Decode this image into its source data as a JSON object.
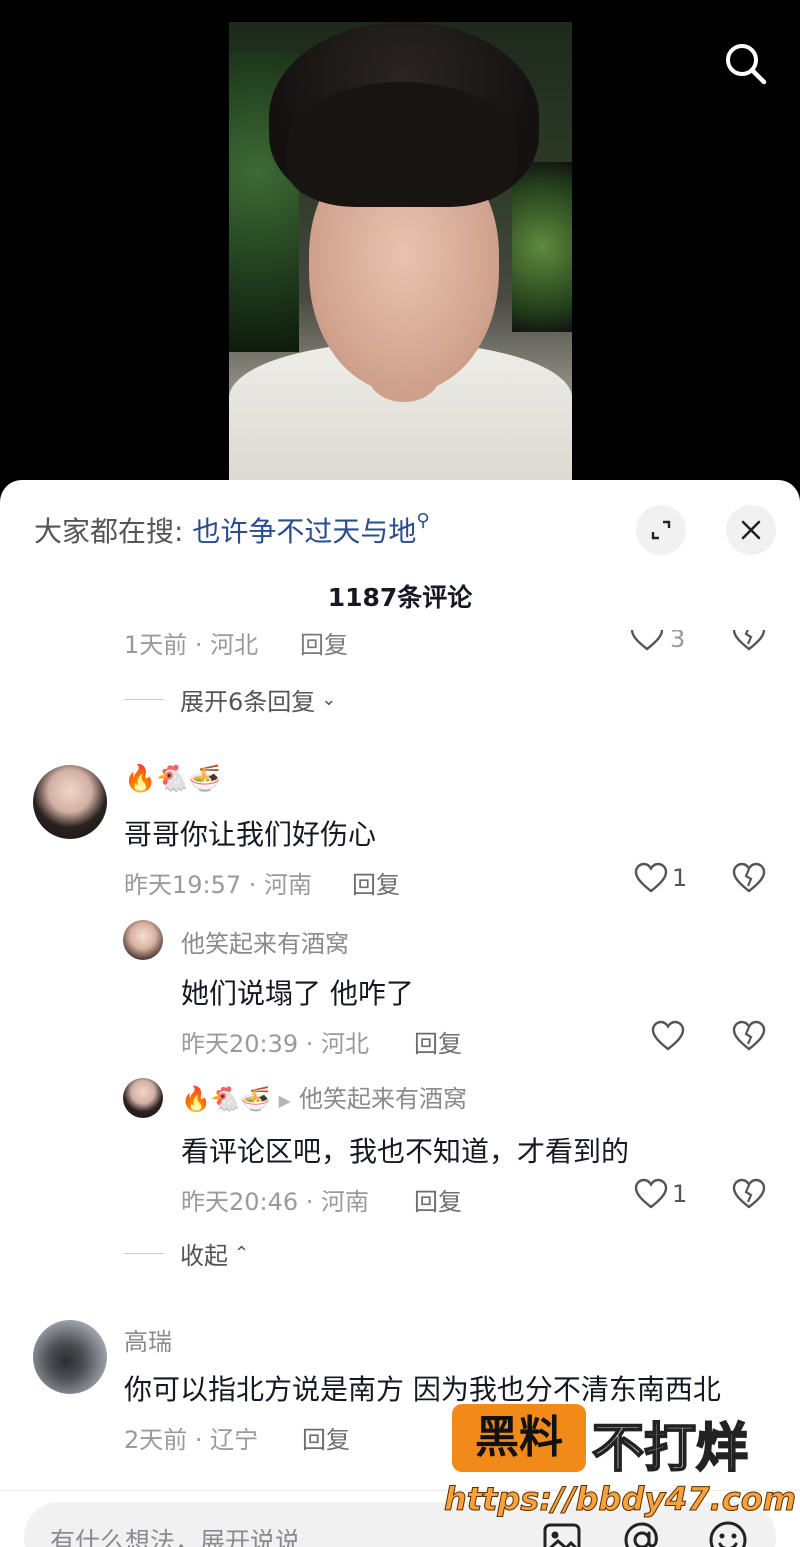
{
  "hot_search": {
    "prefix": "大家都在搜:",
    "term": "也许争不过天与地",
    "icon": "search-icon"
  },
  "comment_count_title": "1187条评论",
  "cut_off_comment": {
    "meta": "1天前 · 河北",
    "reply_label": "回复",
    "likes": "3"
  },
  "expand_replies_label": "展开6条回复",
  "comments": [
    {
      "user": "🔥🐔🍜",
      "text": "哥哥你让我们好伤心",
      "meta": "昨天19:57 · 河南",
      "reply_label": "回复",
      "likes": "1"
    },
    {
      "user": "他笑起来有酒窝",
      "text": "她们说塌了 他咋了",
      "meta": "昨天20:39 · 河北",
      "reply_label": "回复",
      "likes": ""
    },
    {
      "user": "🔥🐔🍜",
      "reply_to": "他笑起来有酒窝",
      "text": "看评论区吧，我也不知道，才看到的",
      "meta": "昨天20:46 · 河南",
      "reply_label": "回复",
      "likes": "1"
    },
    {
      "user": "高瑞",
      "text": "你可以指北方说是南方 因为我也分不清东南西北",
      "meta": "2天前 · 辽宁",
      "reply_label": "回复",
      "likes": ""
    }
  ],
  "collapse_label": "收起",
  "input": {
    "placeholder": "有什么想法，展开说说"
  },
  "watermark": {
    "badge": "黑料",
    "text": "不打烊",
    "url": "https://bbdy47.com"
  },
  "colors": {
    "accent_link": "#2a4d8f",
    "watermark_orange": "#f28a1a"
  }
}
